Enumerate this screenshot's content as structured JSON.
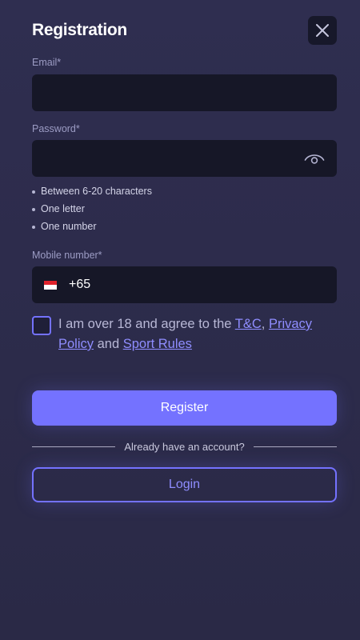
{
  "header": {
    "title": "Registration",
    "close_icon": "close-icon"
  },
  "email": {
    "label": "Email*",
    "value": "",
    "placeholder": ""
  },
  "password": {
    "label": "Password*",
    "value": "",
    "placeholder": "",
    "toggle_icon": "eye-icon",
    "rules": [
      "Between 6-20 characters",
      "One letter",
      "One number"
    ]
  },
  "mobile": {
    "label": "Mobile number*",
    "flag_icon": "singapore-flag-icon",
    "dial_code": "+65",
    "value": ""
  },
  "consent": {
    "checked": false,
    "text_before": "I am over 18 and agree to the ",
    "link_tc": "T&C",
    "separator": ", ",
    "link_privacy": "Privacy Policy",
    "text_and": " and ",
    "link_sport_rules": "Sport Rules"
  },
  "actions": {
    "register_label": "Register",
    "divider_text": "Already have an account?",
    "login_label": "Login"
  },
  "colors": {
    "background": "#2f2e50",
    "input_background": "#161727",
    "accent": "#7472ff",
    "link": "#8f8dff",
    "label": "#9c9cc4"
  }
}
